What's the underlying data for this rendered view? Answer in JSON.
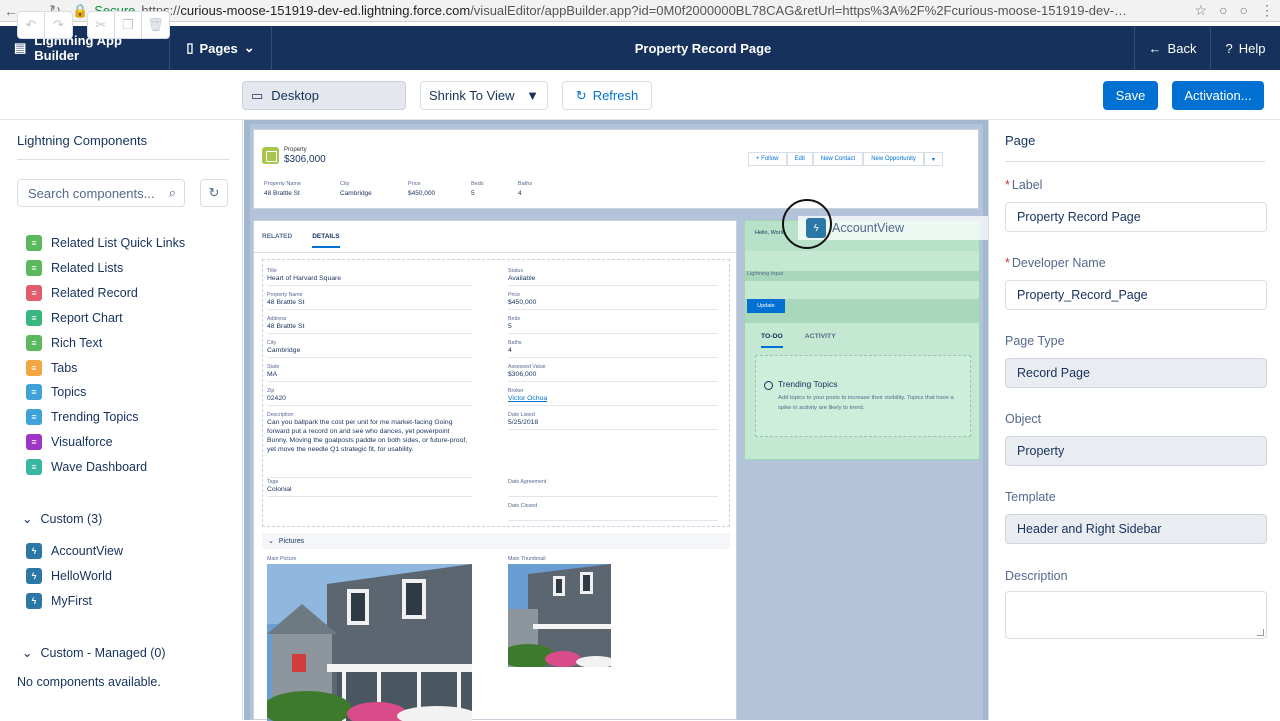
{
  "browser": {
    "secure_label": "Secure",
    "url_scheme": "https://",
    "url_host": "curious-moose-151919-dev-ed.lightning.force.com",
    "url_path": "/visualEditor/appBuilder.app?id=0M0f2000000BL78CAG&retUrl=https%3A%2F%2Fcurious-moose-151919-dev-…"
  },
  "topbar": {
    "app_name": "Lightning App Builder",
    "pages_label": "Pages",
    "title": "Property Record Page",
    "back_label": "Back",
    "help_label": "Help"
  },
  "toolbar": {
    "device_label": "Desktop",
    "view_mode": "Shrink To View",
    "refresh_label": "Refresh",
    "save_label": "Save",
    "activation_label": "Activation..."
  },
  "left_panel": {
    "heading": "Lightning Components",
    "search_placeholder": "Search components...",
    "standard": [
      {
        "label": "Related List Quick Links",
        "color": "#5cb85c"
      },
      {
        "label": "Related Lists",
        "color": "#5cb85c"
      },
      {
        "label": "Related Record",
        "color": "#e05d6f"
      },
      {
        "label": "Report Chart",
        "color": "#38b77f"
      },
      {
        "label": "Rich Text",
        "color": "#5cb85c"
      },
      {
        "label": "Tabs",
        "color": "#f2a541"
      },
      {
        "label": "Topics",
        "color": "#3fa2d8"
      },
      {
        "label": "Trending Topics",
        "color": "#3fa2d8"
      },
      {
        "label": "Visualforce",
        "color": "#9e35c5"
      },
      {
        "label": "Wave Dashboard",
        "color": "#38b79f"
      }
    ],
    "custom_section": "Custom (3)",
    "custom": [
      {
        "label": "AccountView"
      },
      {
        "label": "HelloWorld"
      },
      {
        "label": "MyFirst"
      }
    ],
    "managed_section": "Custom - Managed (0)",
    "managed_empty": "No components available."
  },
  "canvas": {
    "header": {
      "object_label": "Property",
      "price": "$306,000",
      "buttons": [
        "+ Follow",
        "Edit",
        "New Contact",
        "New Opportunity"
      ],
      "highlights": [
        {
          "label": "Property Name",
          "value": "48 Brattle St"
        },
        {
          "label": "City",
          "value": "Cambridge"
        },
        {
          "label": "Price",
          "value": "$450,000"
        },
        {
          "label": "Beds",
          "value": "5"
        },
        {
          "label": "Baths",
          "value": "4"
        }
      ]
    },
    "detail_tabs": [
      "RELATED",
      "DETAILS"
    ],
    "fields_left": [
      {
        "label": "Title",
        "value": "Heart of Harvard Square"
      },
      {
        "label": "Property Name",
        "value": "48 Brattle St"
      },
      {
        "label": "Address",
        "value": "48 Brattle St"
      },
      {
        "label": "City",
        "value": "Cambridge"
      },
      {
        "label": "State",
        "value": "MA"
      },
      {
        "label": "Zip",
        "value": "02420"
      },
      {
        "label": "Description",
        "value": "Can you ballpark the cost per unit for me market-facing Going forward put a record on and see who dances, yet powerpoint Bunny. Moving the goalposts paddle on both sides, or future-proof, yet move the needle Q1 strategic fit, for usability."
      },
      {
        "label": "Tags",
        "value": "Colonial"
      }
    ],
    "fields_right": [
      {
        "label": "Status",
        "value": "Available"
      },
      {
        "label": "Price",
        "value": "$450,000"
      },
      {
        "label": "Beds",
        "value": "5"
      },
      {
        "label": "Baths",
        "value": "4"
      },
      {
        "label": "Assessed Value",
        "value": "$306,000"
      },
      {
        "label": "Broker",
        "value": "Victor Ochoa"
      },
      {
        "label": "Date Listed",
        "value": "5/25/2018"
      },
      {
        "label": "Date Agreement",
        "value": ""
      },
      {
        "label": "Date Closed",
        "value": ""
      }
    ],
    "pictures_section": "Pictures",
    "main_picture_label": "Main Picture",
    "main_thumbnail_label": "Main Thumbnail",
    "sidebar": {
      "hello_world": "Hello, World",
      "lightning_input": "Lightning Input",
      "update_button": "Update",
      "tabs": [
        "TO-DO",
        "ACTIVITY"
      ],
      "trending_title": "Trending Topics",
      "trending_desc": "Add topics to your posts to increase their visibility. Topics that have a spike in activity are likely to trend."
    },
    "dragging_component": "AccountView"
  },
  "right_panel": {
    "heading": "Page",
    "label_field": {
      "label": "Label",
      "value": "Property Record Page"
    },
    "developer_name": {
      "label": "Developer Name",
      "value": "Property_Record_Page"
    },
    "page_type": {
      "label": "Page Type",
      "value": "Record Page"
    },
    "object": {
      "label": "Object",
      "value": "Property"
    },
    "template": {
      "label": "Template",
      "value": "Header and Right Sidebar"
    },
    "description": {
      "label": "Description",
      "value": ""
    }
  }
}
